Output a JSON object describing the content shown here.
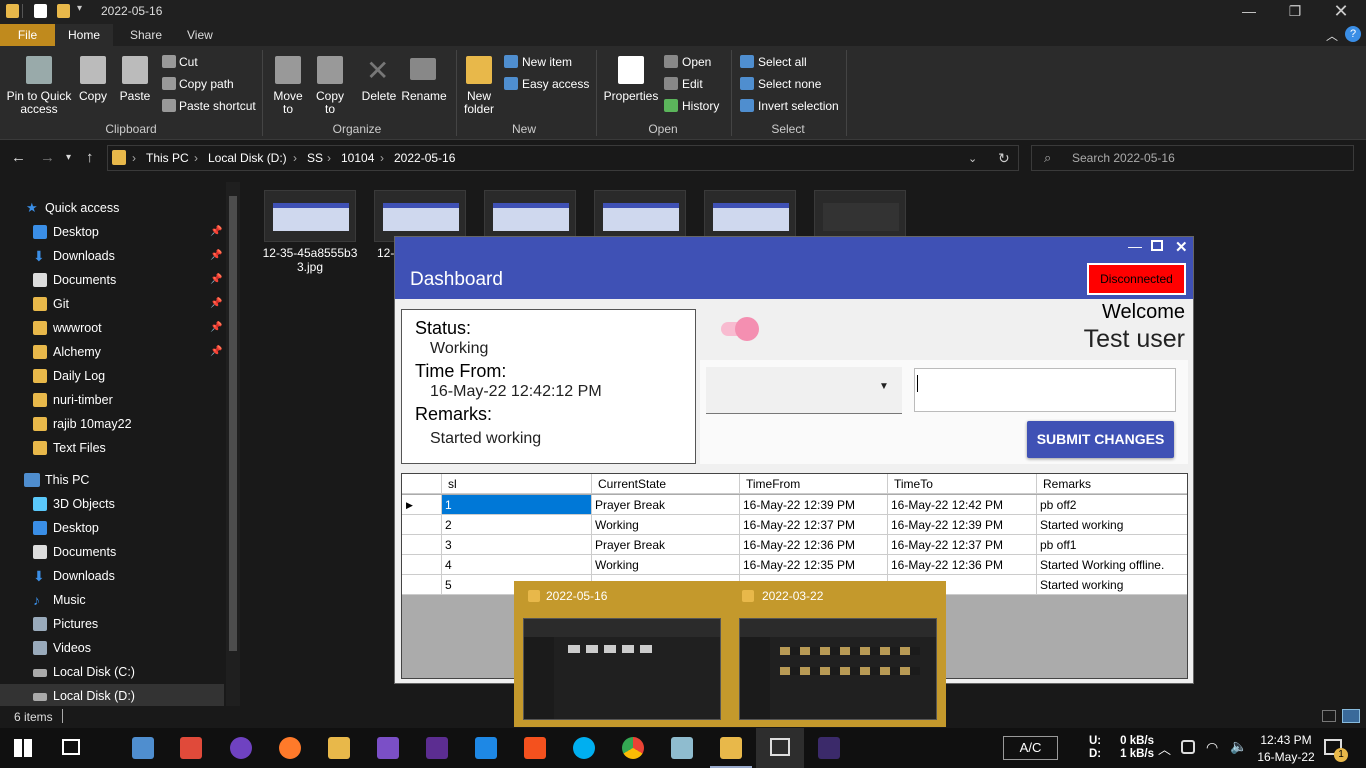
{
  "explorer": {
    "title": "2022-05-16",
    "ribbon_tabs": [
      "File",
      "Home",
      "Share",
      "View"
    ],
    "clipboard": {
      "pin": "Pin to Quick access",
      "copy": "Copy",
      "paste": "Paste",
      "cut": "Cut",
      "copy_path": "Copy path",
      "paste_shortcut": "Paste shortcut",
      "group": "Clipboard"
    },
    "organize": {
      "move_to": "Move to",
      "copy_to": "Copy to",
      "delete": "Delete",
      "rename": "Rename",
      "group": "Organize"
    },
    "new": {
      "new_folder": "New folder",
      "new_item": "New item",
      "easy_access": "Easy access",
      "group": "New"
    },
    "open": {
      "properties": "Properties",
      "open": "Open",
      "edit": "Edit",
      "history": "History",
      "group": "Open"
    },
    "select": {
      "select_all": "Select all",
      "select_none": "Select none",
      "invert": "Invert selection",
      "group": "Select"
    },
    "breadcrumb": [
      "This PC",
      "Local Disk (D:)",
      "SS",
      "10104",
      "2022-05-16"
    ],
    "search_placeholder": "Search 2022-05-16",
    "nav": {
      "quick_access": "Quick access",
      "pinned": [
        "Desktop",
        "Downloads",
        "Documents",
        "Git",
        "wwwroot",
        "Alchemy"
      ],
      "folders": [
        "Daily Log",
        "nuri-timber",
        "rajib 10may22",
        "Text Files"
      ],
      "this_pc": "This PC",
      "pc_items": [
        "3D Objects",
        "Desktop",
        "Documents",
        "Downloads",
        "Music",
        "Pictures",
        "Videos",
        "Local Disk (C:)",
        "Local Disk (D:)"
      ]
    },
    "files": [
      {
        "name_line1": "12-35-45a8555b3",
        "name_line2": "3.jpg"
      },
      {
        "name_line1": "12-",
        "name_line2": ""
      }
    ],
    "status": "6 items"
  },
  "dashboard": {
    "title": "Dashboard",
    "connection": "Disconnected",
    "status_label": "Status:",
    "status_value": "Working",
    "time_from_label": "Time From:",
    "time_from_value": "16-May-22 12:42:12 PM",
    "remarks_label": "Remarks:",
    "remarks_value": "Started working",
    "welcome": "Welcome",
    "user": "Test user",
    "submit": "SUBMIT CHANGES",
    "columns": [
      "sl",
      "CurrentState",
      "TimeFrom",
      "TimeTo",
      "Remarks"
    ],
    "rows": [
      {
        "sl": "1",
        "state": "Prayer Break",
        "from": "16-May-22 12:39 PM",
        "to": "16-May-22 12:42 PM",
        "remarks": "pb off2"
      },
      {
        "sl": "2",
        "state": "Working",
        "from": "16-May-22 12:37 PM",
        "to": "16-May-22 12:39 PM",
        "remarks": "Started working"
      },
      {
        "sl": "3",
        "state": "Prayer Break",
        "from": "16-May-22 12:36 PM",
        "to": "16-May-22 12:37 PM",
        "remarks": "pb off1"
      },
      {
        "sl": "4",
        "state": "Working",
        "from": "16-May-22 12:35 PM",
        "to": "16-May-22 12:36 PM",
        "remarks": "Started Working offline."
      },
      {
        "sl": "5",
        "state": "",
        "from": "",
        "to": "",
        "remarks": "Started working"
      }
    ]
  },
  "preview": {
    "left_title": "2022-05-16",
    "right_title": "2022-03-22"
  },
  "taskbar": {
    "ac": "A/C",
    "net_u_label": "U:",
    "net_d_label": "D:",
    "net_up": "0 kB/s",
    "net_down": "1 kB/s",
    "time": "12:43 PM",
    "date": "16-May-22",
    "notifications": "1"
  },
  "colors": {
    "accent": "#3f51b5",
    "file_tab": "#c08a1d",
    "disconnected": "#ff0000",
    "selection": "#0078d7"
  }
}
